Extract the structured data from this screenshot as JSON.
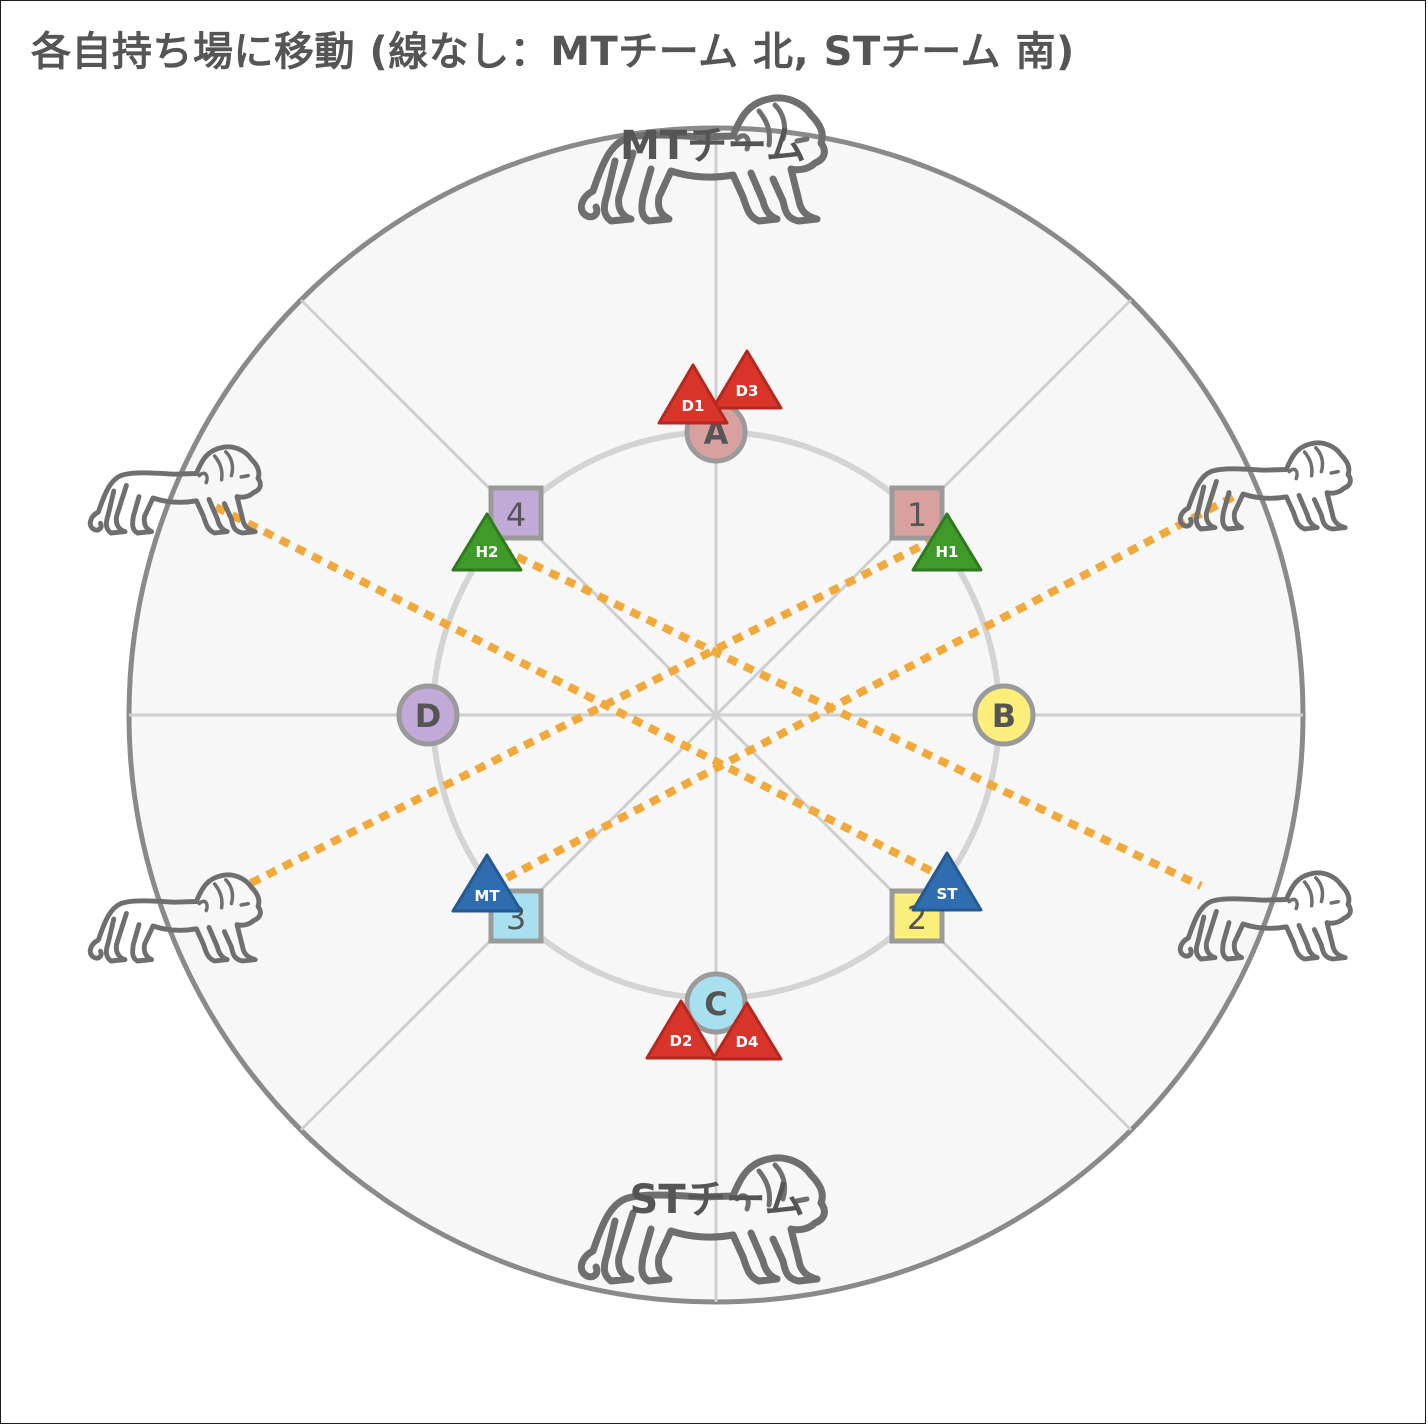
{
  "title": "各自持ち場に移動 (線なし：MTチーム 北, STチーム 南)",
  "colors": {
    "arena_fill": "#f7f7f7",
    "arena_border": "#8a8a8a",
    "grid_line": "#cfcfcf",
    "tether": "#f0a93a",
    "dps": "#d9342a",
    "healer": "#3f9a2a",
    "tank": "#2f6db0",
    "marker_A": "#d9a0a0",
    "marker_B": "#fbee7a",
    "marker_C": "#a8e0f0",
    "marker_D": "#c2aad8",
    "marker_1": "#d9a0a0",
    "marker_2": "#fbee7a",
    "marker_3": "#a8e0f0",
    "marker_4": "#c2aad8"
  },
  "team_labels": {
    "north": "MTチーム",
    "south": "STチーム"
  },
  "waymarks": {
    "A": "A",
    "B": "B",
    "C": "C",
    "D": "D",
    "one": "1",
    "two": "2",
    "three": "3",
    "four": "4"
  },
  "players": {
    "D1": "D1",
    "D3": "D3",
    "D2": "D2",
    "D4": "D4",
    "H1": "H1",
    "H2": "H2",
    "MT": "MT",
    "ST": "ST"
  },
  "icons": {
    "boss": "lion-icon"
  }
}
